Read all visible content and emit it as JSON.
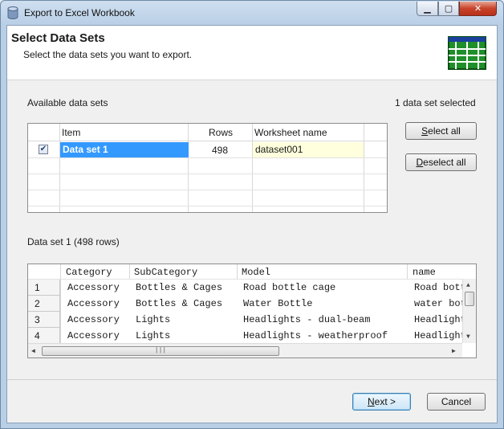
{
  "window": {
    "title": "Export to Excel Workbook",
    "controls": {
      "minimize": "▁",
      "maximize": "▢",
      "close": "✕"
    }
  },
  "header": {
    "title": "Select Data Sets",
    "subtitle": "Select the data sets you want to export.",
    "icon": "spreadsheet-grid-icon"
  },
  "datasets": {
    "label": "Available data sets",
    "selected_count": "1 data set selected",
    "columns": [
      "Item",
      "Rows",
      "Worksheet name"
    ],
    "rows": [
      {
        "checked": true,
        "item": "Data set 1",
        "rows": "498",
        "worksheet": "dataset001"
      }
    ],
    "select_all": "Select all",
    "deselect_all": "Deselect all"
  },
  "preview": {
    "label": "Data set 1 (498 rows)",
    "columns": [
      "Category",
      "SubCategory",
      "Model",
      "name"
    ],
    "rows": [
      {
        "num": "1",
        "cells": [
          "Accessory",
          "Bottles & Cages",
          "Road bottle cage",
          "Road bottle cage"
        ]
      },
      {
        "num": "2",
        "cells": [
          "Accessory",
          "Bottles & Cages",
          "Water Bottle",
          "water bottle"
        ]
      },
      {
        "num": "3",
        "cells": [
          "Accessory",
          "Lights",
          "Headlights - dual-beam",
          "Headlights - dual-beam"
        ]
      },
      {
        "num": "4",
        "cells": [
          "Accessory",
          "Lights",
          "Headlights - weatherproof",
          "Headlights - weatherproof"
        ]
      }
    ],
    "scroll_thumb_grip": "|||"
  },
  "footer": {
    "next": "Next >",
    "cancel": "Cancel"
  }
}
